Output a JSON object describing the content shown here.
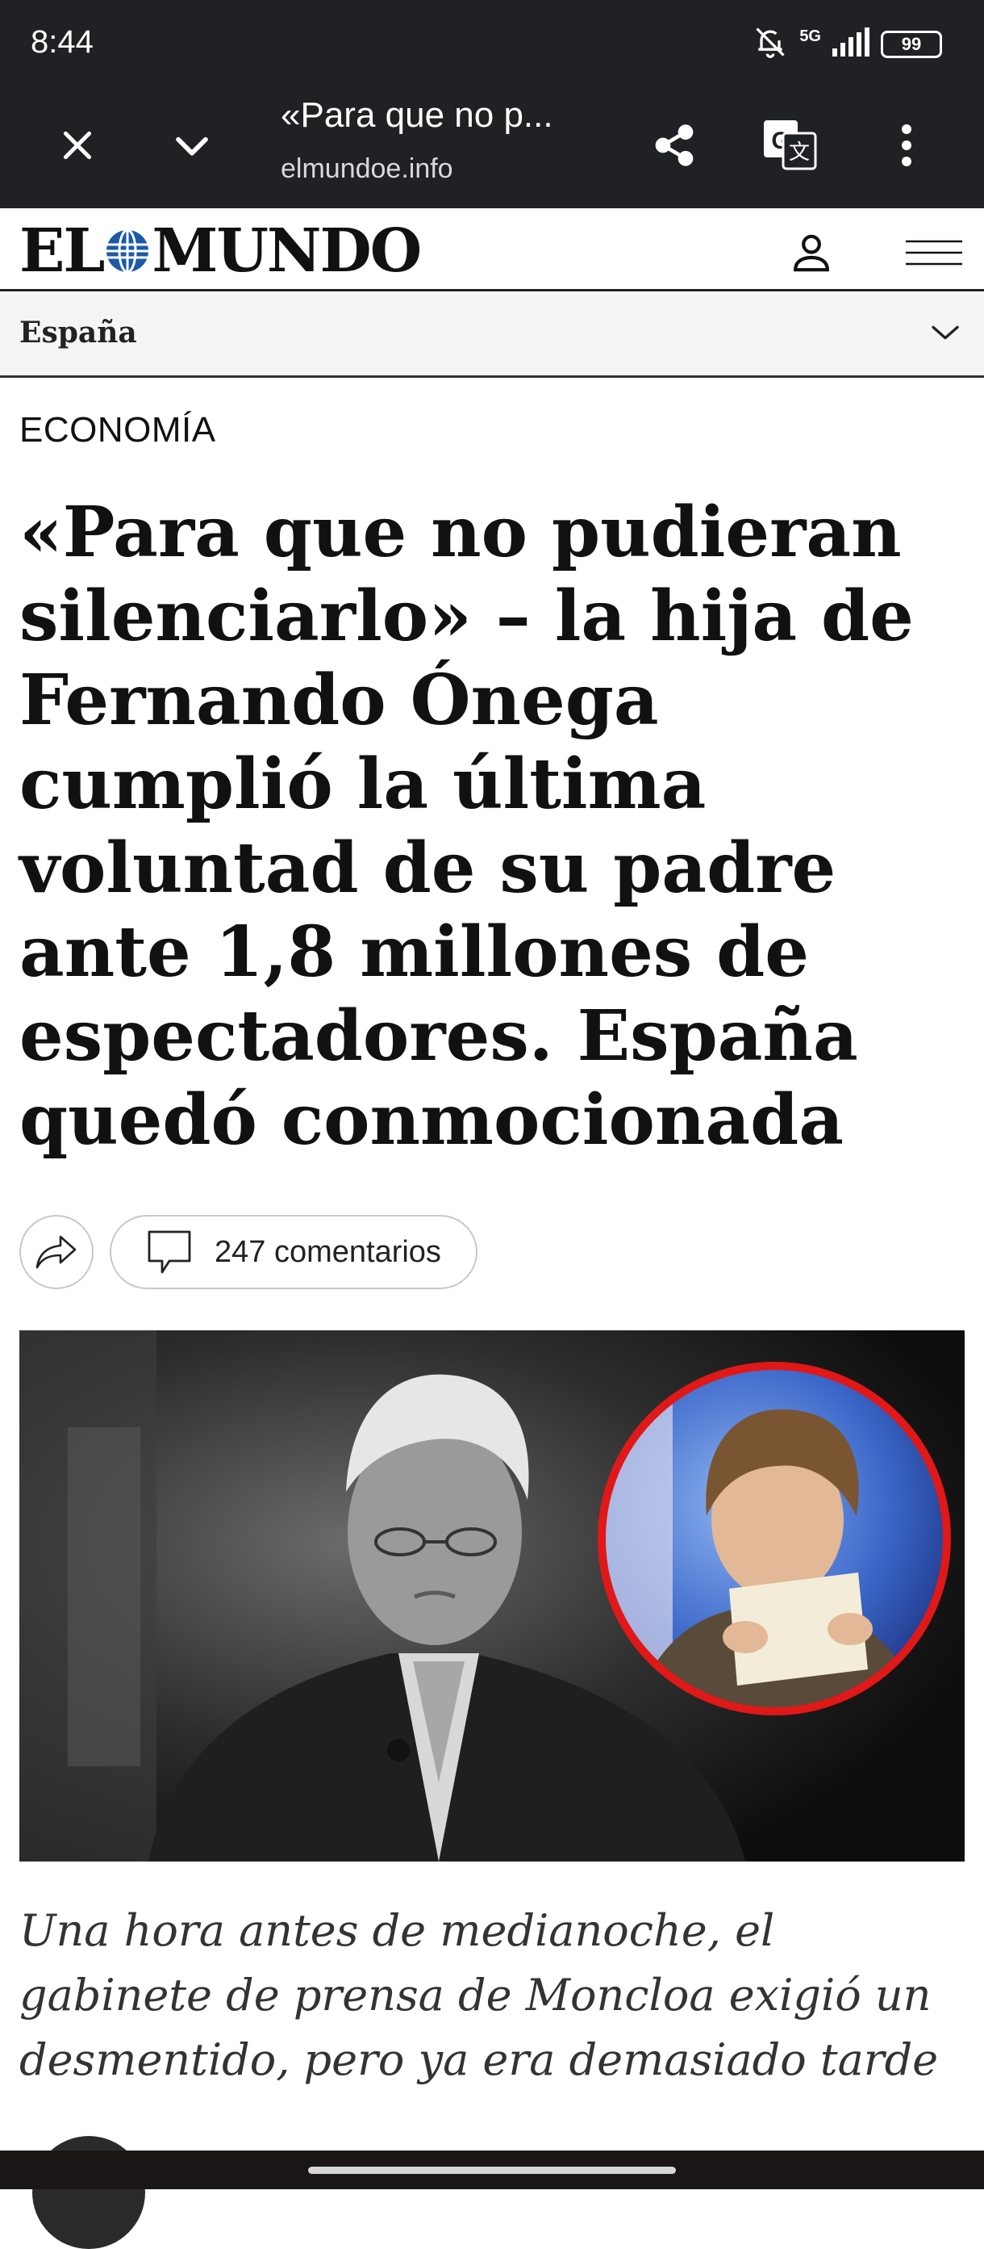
{
  "status_bar": {
    "time": "8:44",
    "network": "5G",
    "battery": "99",
    "icons": [
      "bell-off-icon",
      "signal-icon",
      "battery-icon"
    ]
  },
  "browser": {
    "page_title": "«Para que no p...",
    "url": "elmundoe.info",
    "icons": [
      "close-icon",
      "chevron-down-icon",
      "share-icon",
      "translate-icon",
      "more-vert-icon"
    ]
  },
  "site": {
    "logo_left": "EL",
    "logo_right": "MUNDO",
    "icons": [
      "user-icon",
      "menu-icon"
    ]
  },
  "section": {
    "label": "España",
    "icon": "chevron-down-icon"
  },
  "article": {
    "kicker": "ECONOMÍA",
    "headline": "«Para que no pudieran silenciarlo» – la hija de Fernando Ónega cumplió la última voluntad de su padre ante 1,8 millones de espectadores. España quedó conmocionada",
    "comments_label": "247 comentarios",
    "caption": "Una hora antes de medianoche, el gabinete de prensa de Moncloa exigió un desmentido, pero ya era demasiado tarde"
  },
  "colors": {
    "browser_bg": "#1f2125",
    "globe_blue": "#1c5aa6",
    "inset_ring": "#e01818"
  }
}
